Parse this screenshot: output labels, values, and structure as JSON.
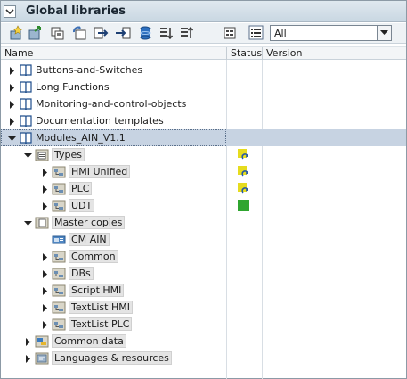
{
  "window": {
    "title": "Global libraries"
  },
  "toolbar": {
    "filter": {
      "value": "All"
    },
    "buttons": [
      "create-library-icon",
      "open-library-icon",
      "save-library-icon",
      "update-library-icon",
      "export-icon",
      "import-icon",
      "storage-icon",
      "sort-down-icon",
      "sort-up-icon",
      "properties-icon",
      "list-view-icon"
    ]
  },
  "columns": {
    "name": "Name",
    "status": "Status",
    "version": "Version"
  },
  "colors": {
    "selection": "#c7d3e2",
    "status_update": "#e6dc1e",
    "status_ok": "#2fa52f"
  },
  "rows": [
    {
      "label": "Buttons-and-Switches"
    },
    {
      "label": "Long Functions"
    },
    {
      "label": "Monitoring-and-control-objects"
    },
    {
      "label": "Documentation templates"
    },
    {
      "label": "Modules_AIN_V1.1"
    },
    {
      "label": "Types"
    },
    {
      "label": "HMI Unified"
    },
    {
      "label": "PLC"
    },
    {
      "label": "UDT"
    },
    {
      "label": "Master copies"
    },
    {
      "label": "CM AIN"
    },
    {
      "label": "Common"
    },
    {
      "label": "DBs"
    },
    {
      "label": "Script HMI"
    },
    {
      "label": "TextList HMI"
    },
    {
      "label": "TextList PLC"
    },
    {
      "label": "Common data"
    },
    {
      "label": "Languages & resources"
    }
  ]
}
